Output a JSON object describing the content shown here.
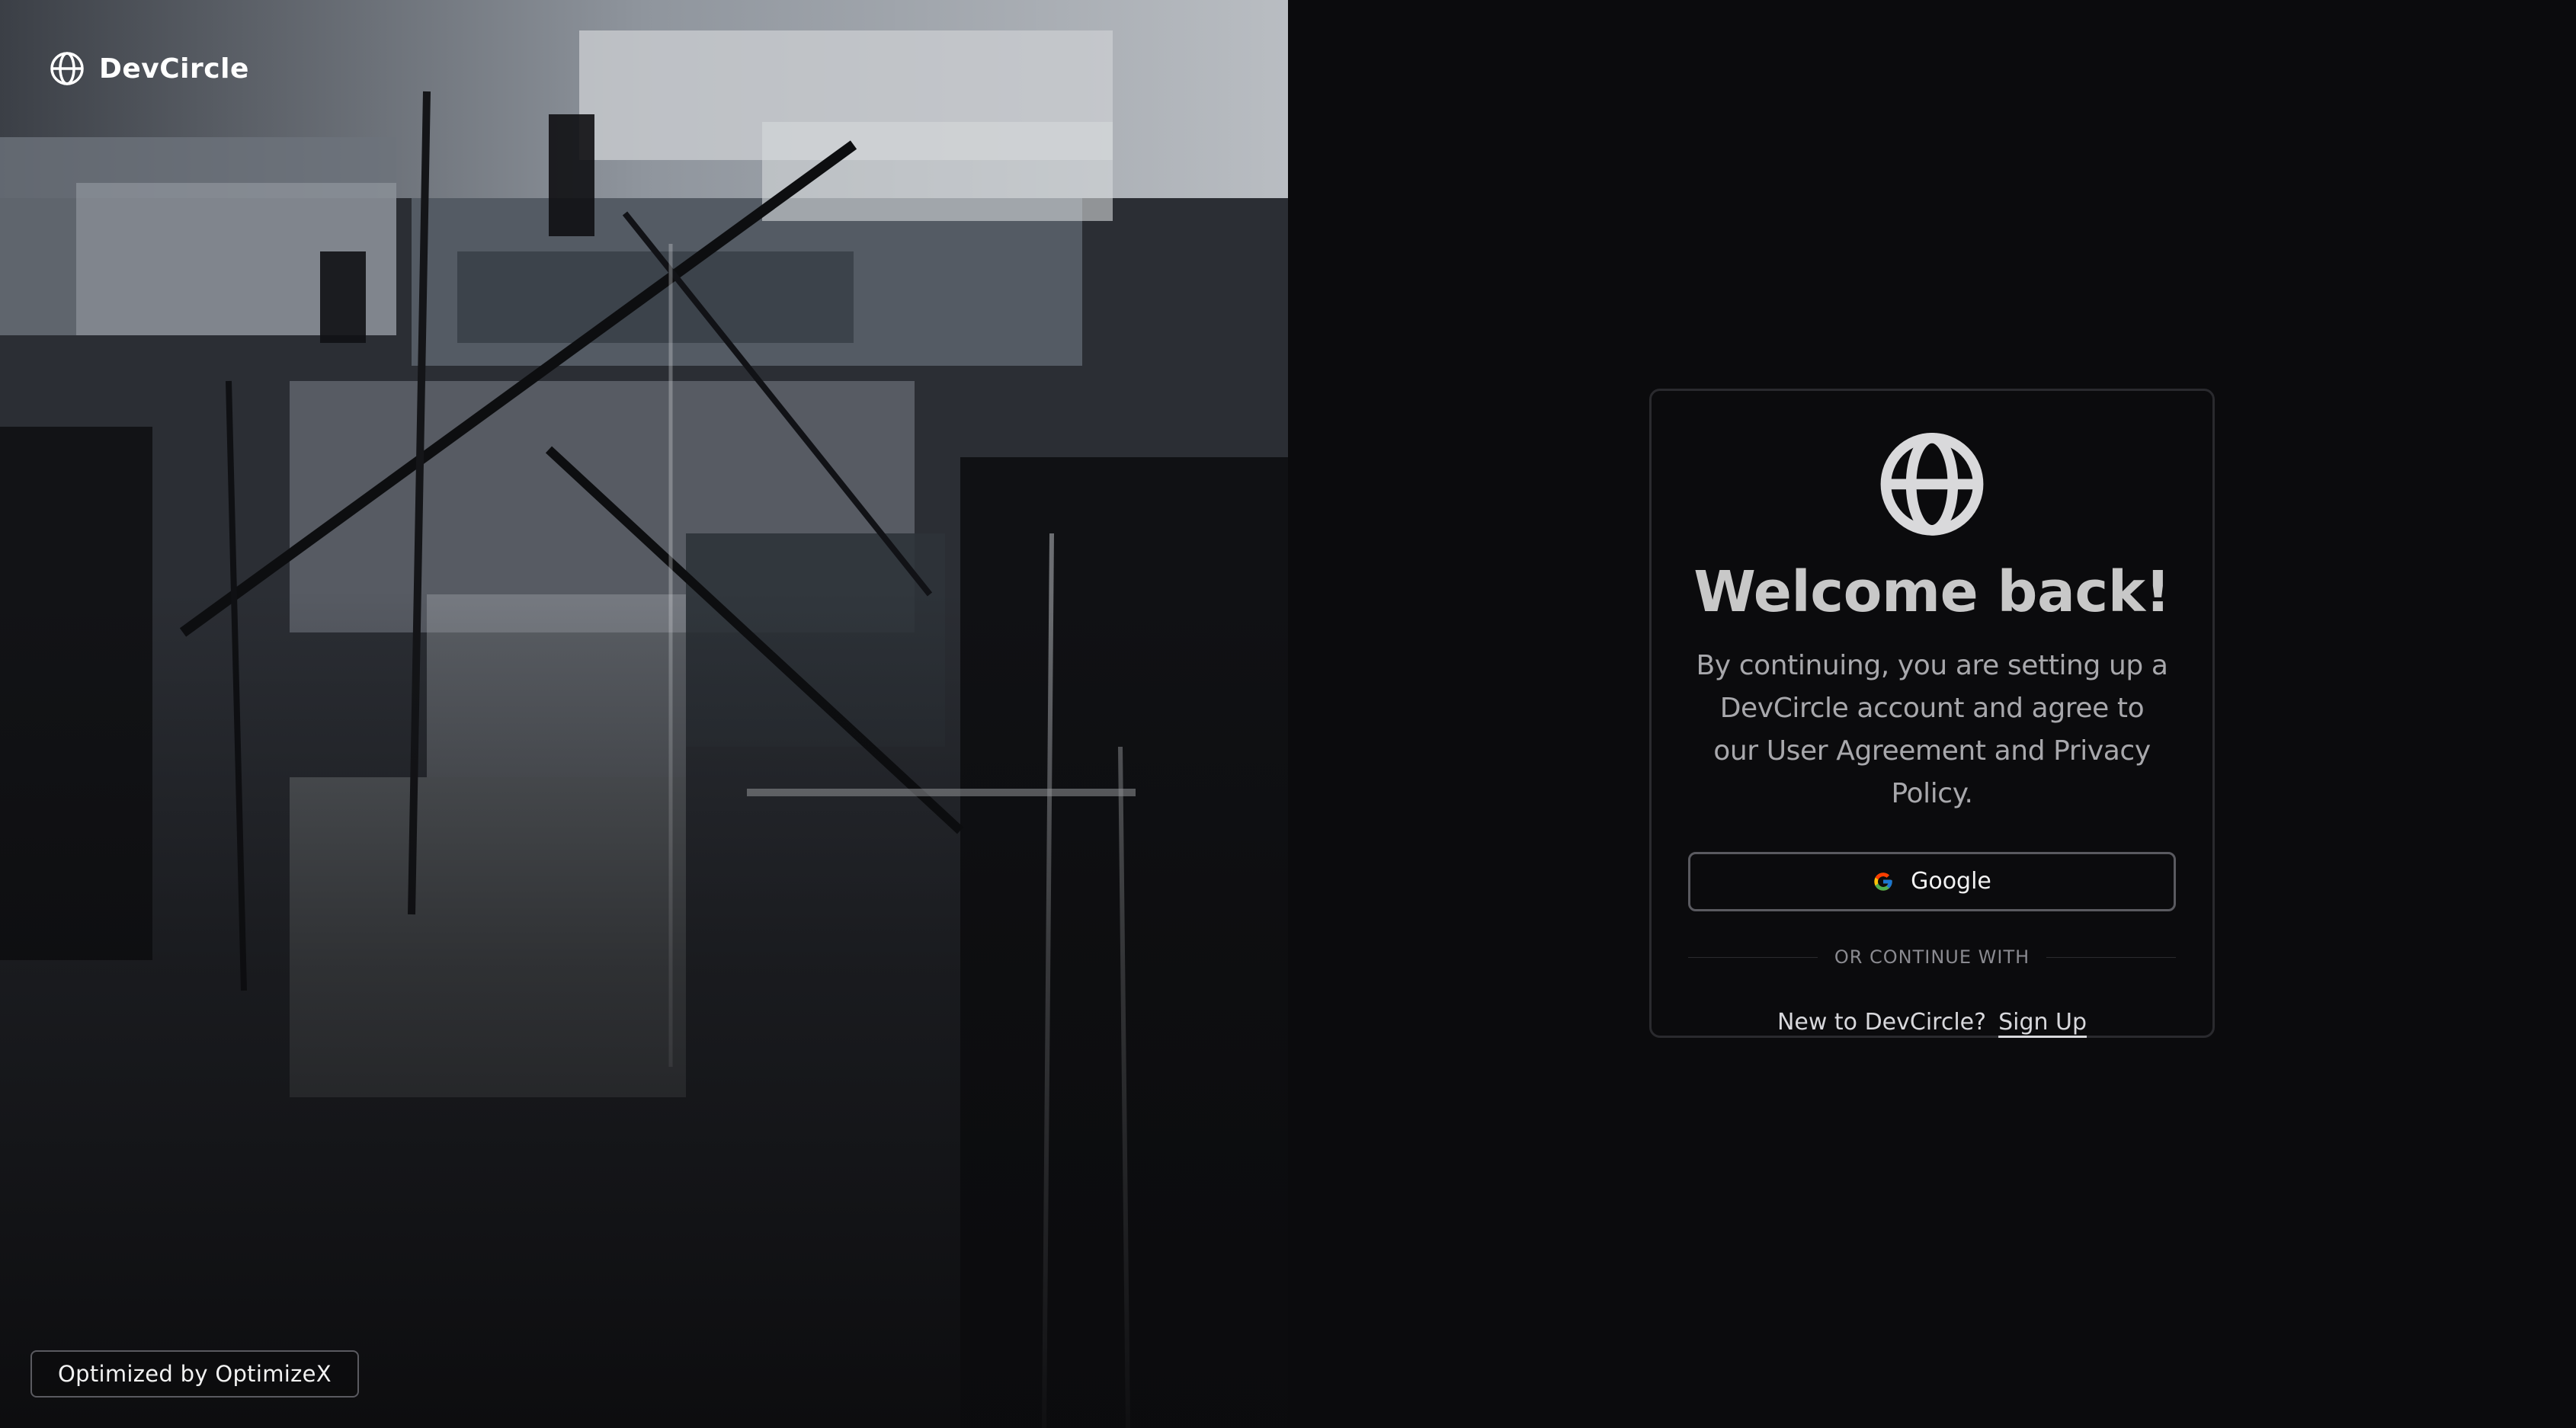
{
  "brand": {
    "name": "DevCircle",
    "icon": "globe-icon"
  },
  "credit": {
    "label": "Optimized by OptimizeX"
  },
  "login_card": {
    "logo_icon": "globe-icon",
    "title": "Welcome back!",
    "subtitle": "By continuing, you are setting up a DevCircle account and agree to our User Agreement and Privacy Policy.",
    "google_button": {
      "icon": "google-icon",
      "label": "Google"
    },
    "divider_text": "OR CONTINUE WITH",
    "signup_prompt": "New to DevCircle?",
    "signup_link": "Sign Up"
  },
  "colors": {
    "background": "#0b0b0d",
    "card_border": "#2a2a2e",
    "title": "#c8c8c8",
    "text_muted": "#a8a8ac",
    "button_border": "#5a5a60"
  }
}
